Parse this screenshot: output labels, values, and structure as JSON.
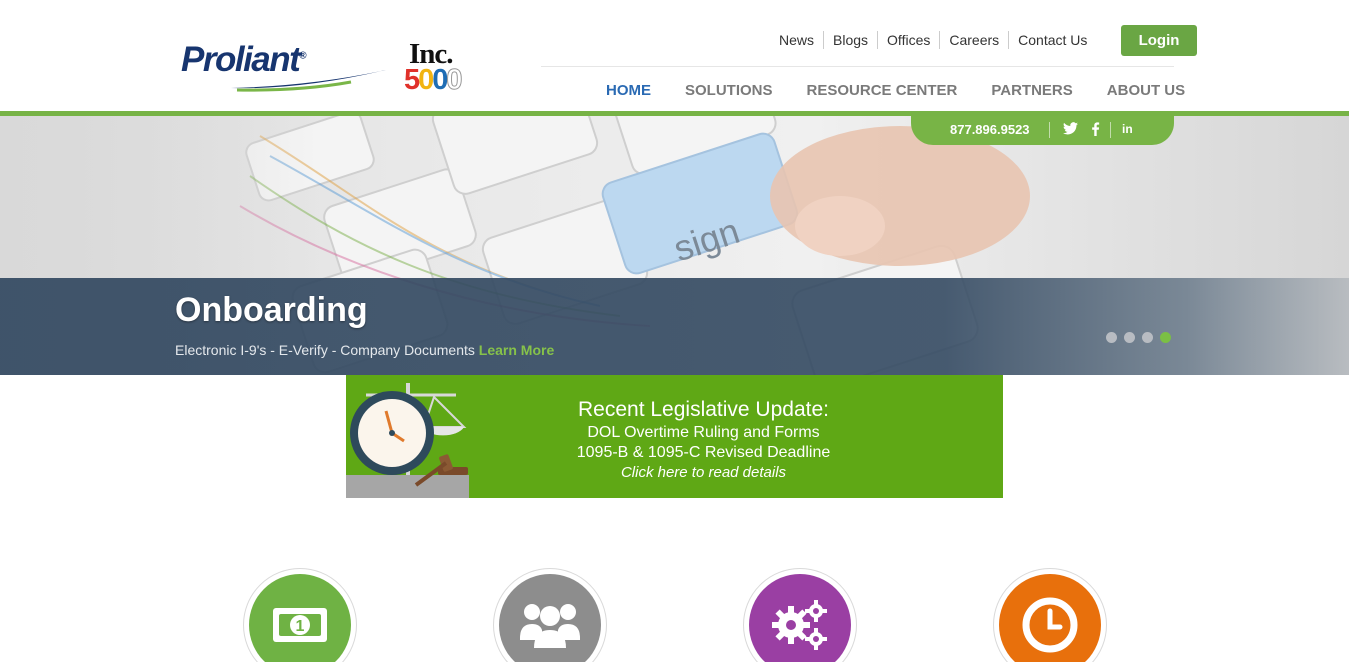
{
  "brand": {
    "logo_text": "Proliant",
    "logo_mark": "®",
    "award_word": "Inc.",
    "award_num": [
      "5",
      "0",
      "0",
      "0"
    ]
  },
  "top_links": [
    "News",
    "Blogs",
    "Offices",
    "Careers",
    "Contact Us"
  ],
  "login_label": "Login",
  "main_nav": [
    {
      "label": "HOME",
      "active": true
    },
    {
      "label": "SOLUTIONS",
      "active": false
    },
    {
      "label": "RESOURCE CENTER",
      "active": false
    },
    {
      "label": "PARTNERS",
      "active": false
    },
    {
      "label": "ABOUT US",
      "active": false
    }
  ],
  "contact_tab": {
    "phone": "877.896.9523",
    "social": [
      "twitter-icon",
      "facebook-icon",
      "linkedin-icon"
    ]
  },
  "hero": {
    "key_label": "sign",
    "title": "Onboarding",
    "subtitle": "Electronic I-9's - E-Verify - Company Documents",
    "link_label": "Learn More",
    "slides": 4,
    "active_slide": 4
  },
  "banner": {
    "title": "Recent Legislative Update:",
    "line1": "DOL Overtime Ruling and Forms",
    "line2": "1095-B & 1095-C Revised Deadline",
    "cta": "Click here to read details"
  },
  "features": [
    {
      "icon": "money-icon",
      "color": "#6fb244"
    },
    {
      "icon": "group-icon",
      "color": "#8d8d8d"
    },
    {
      "icon": "gears-icon",
      "color": "#9a3fa3"
    },
    {
      "icon": "clock-icon",
      "color": "#e8700c"
    }
  ],
  "colors": {
    "accent_green": "#6aa644",
    "nav_active": "#2a6ab3",
    "hero_overlay": "#324860",
    "banner_green": "#5fa815"
  }
}
